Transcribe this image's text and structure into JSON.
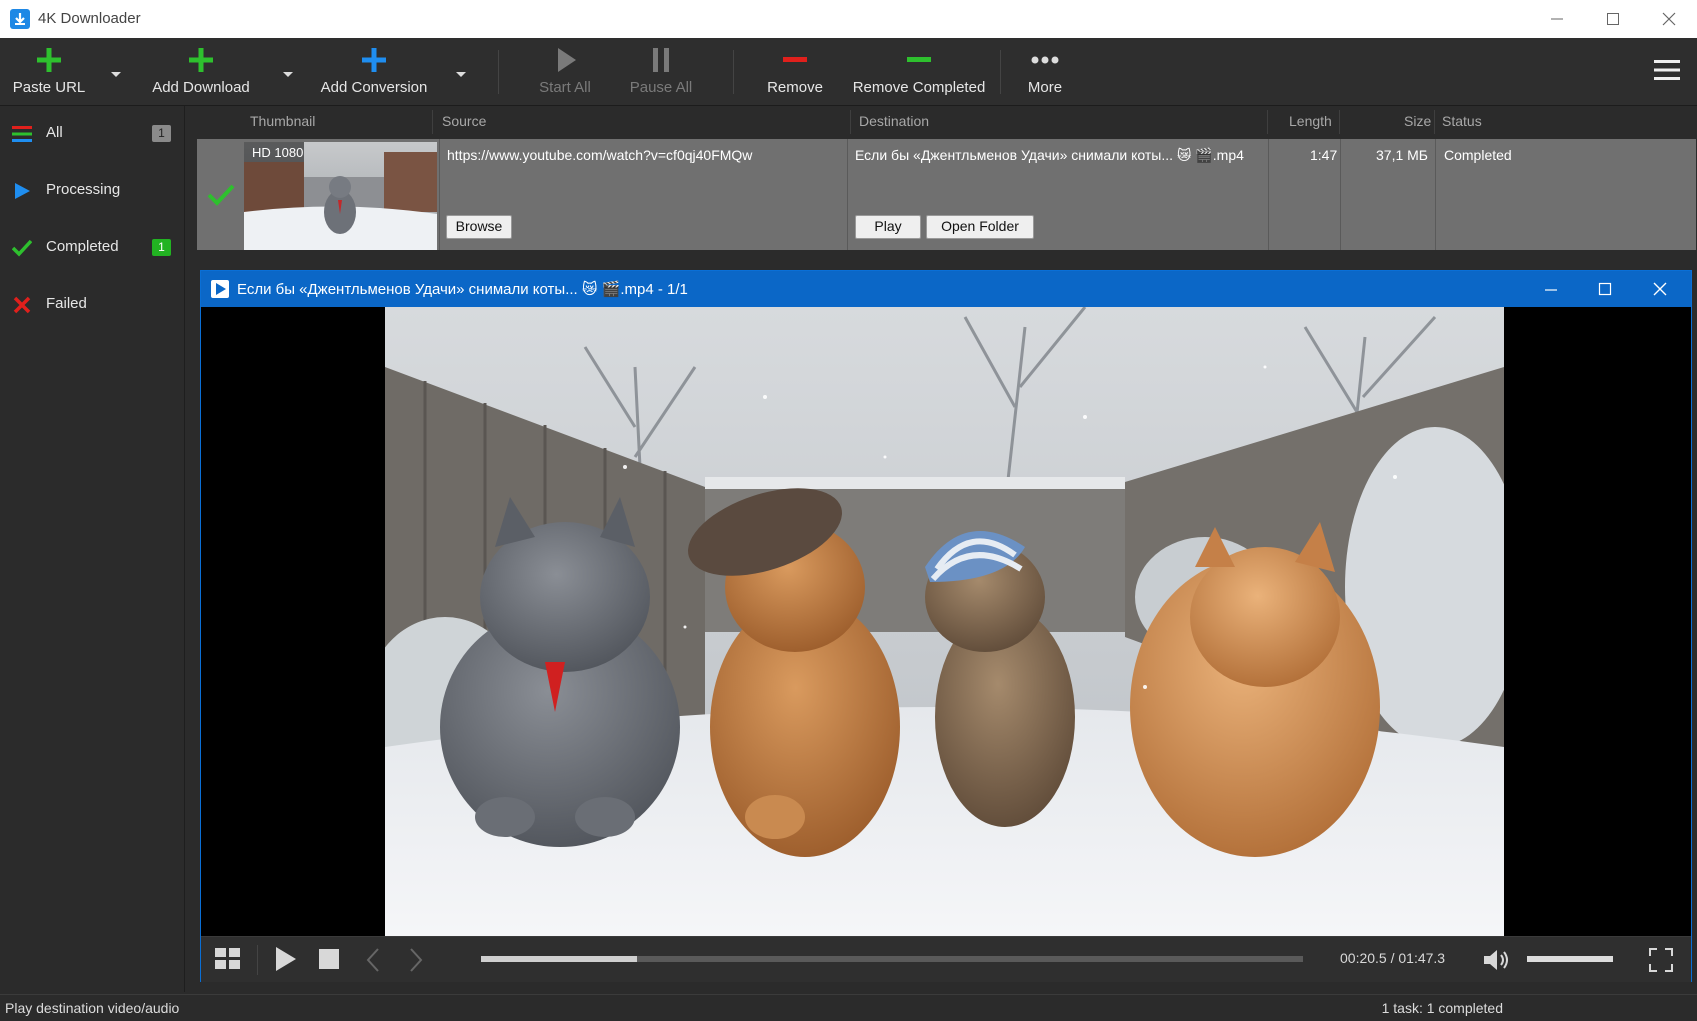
{
  "window": {
    "title": "4K Downloader"
  },
  "toolbar": {
    "paste_url": "Paste URL",
    "add_download": "Add Download",
    "add_conversion": "Add Conversion",
    "start_all": "Start All",
    "pause_all": "Pause All",
    "remove": "Remove",
    "remove_completed": "Remove Completed",
    "more": "More"
  },
  "sidebar": {
    "items": [
      {
        "label": "All",
        "count": "1",
        "icon": "list-icon"
      },
      {
        "label": "Processing",
        "count": "",
        "icon": "play-icon"
      },
      {
        "label": "Completed",
        "count": "1",
        "icon": "check-icon"
      },
      {
        "label": "Failed",
        "count": "",
        "icon": "x-icon"
      }
    ]
  },
  "table": {
    "columns": [
      "Thumbnail",
      "Source",
      "Destination",
      "Length",
      "Size",
      "Status"
    ],
    "rows": [
      {
        "quality_badge": "HD 1080",
        "source": "https://www.youtube.com/watch?v=cf0qj40FMQw",
        "destination": "Если бы «Джентльменов Удачи» снимали коты... 😿 🎬.mp4",
        "length": "1:47",
        "size": "37,1 МБ",
        "status": "Completed",
        "browse_label": "Browse",
        "play_label": "Play",
        "open_folder_label": "Open Folder"
      }
    ]
  },
  "player": {
    "title": "Если бы «Джентльменов Удачи» снимали коты... 😿 🎬.mp4 - 1/1",
    "time": "00:20.5 / 01:47.3",
    "progress_fraction": 0.19,
    "volume_fraction": 1.0
  },
  "statusbar": {
    "left": "Play destination video/audio",
    "right": "1 task: 1 completed"
  },
  "colors": {
    "accent_blue": "#0b67c7",
    "green": "#2ec02e",
    "red": "#e0201c",
    "row_bg": "#707070"
  }
}
